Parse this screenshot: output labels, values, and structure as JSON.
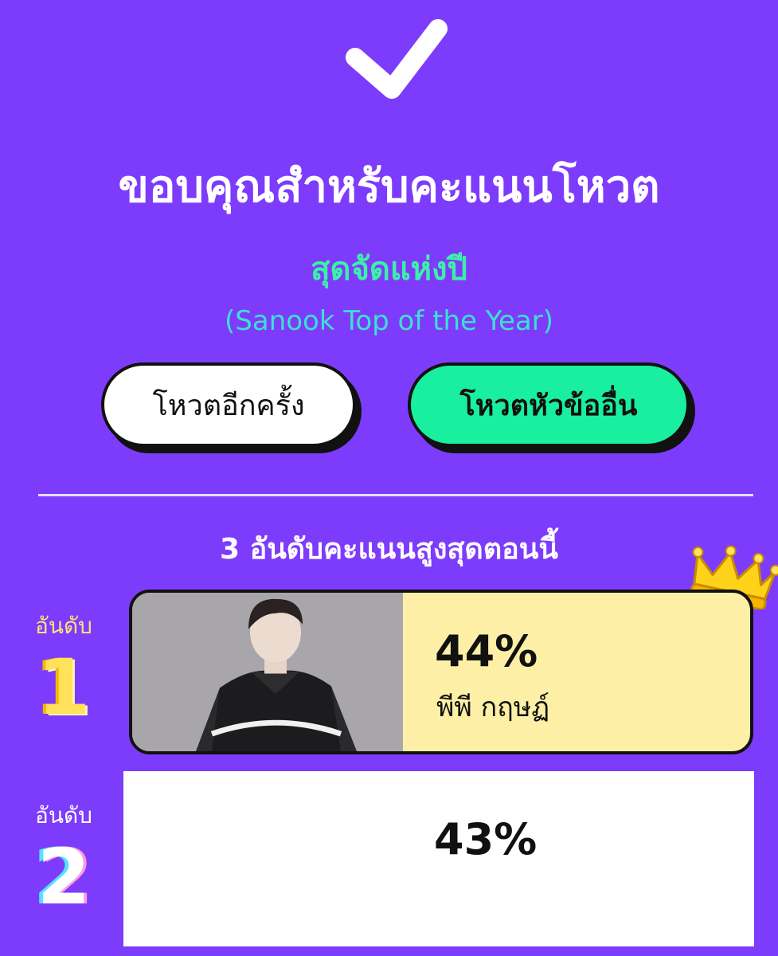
{
  "header": {
    "title": "ขอบคุณสำหรับคะแนนโหวต",
    "category": "สุดจัดแห่งปี",
    "category_en": "(Sanook Top of the Year)"
  },
  "buttons": {
    "vote_again": "โหวตอีกครั้ง",
    "vote_other": "โหวตหัวข้ออื่น"
  },
  "ranking": {
    "heading": "3 อันดับคะแนนสูงสุดตอนนี้",
    "items": [
      {
        "rank_label": "อันดับ",
        "rank": "1",
        "percent": "44%",
        "name": "พีพี กฤษฏ์"
      },
      {
        "rank_label": "อันดับ",
        "rank": "2",
        "percent": "43%"
      }
    ]
  },
  "colors": {
    "background": "#7d3cfb",
    "accent_green": "#18ef9f",
    "rank1_card": "#fdf0a6",
    "category_text": "#3df0a9"
  },
  "icons": {
    "check": "checkmark-icon",
    "crown": "crown-icon"
  }
}
